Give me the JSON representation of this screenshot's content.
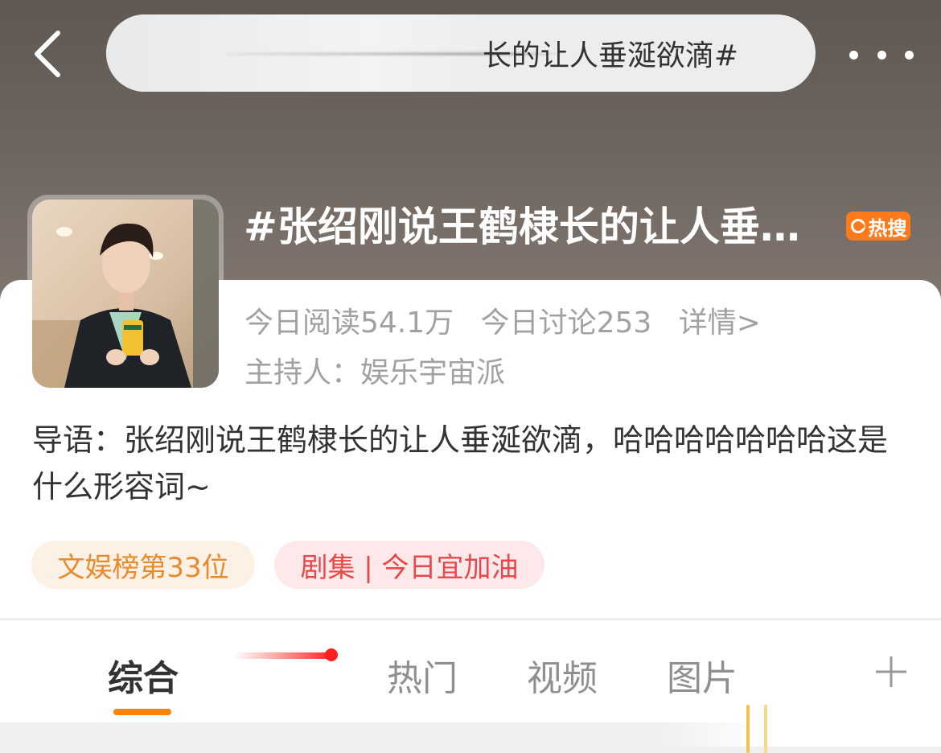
{
  "nav": {
    "search_text": "长的让人垂涎欲滴#"
  },
  "topic": {
    "title": "#张绍刚说王鹤棣长的让人垂…",
    "badge_label": "热搜",
    "stats": {
      "reads": "今日阅读54.1万",
      "discussions": "今日讨论253",
      "details": "详情>"
    },
    "host": "主持人：娱乐宇宙派",
    "intro": "导语：张绍刚说王鹤棣长的让人垂涎欲滴，哈哈哈哈哈哈哈这是什么形容词~",
    "tags": [
      "文娱榜第33位",
      "剧集 | 今日宜加油"
    ]
  },
  "tabs": [
    {
      "label": "综合",
      "active": true
    },
    {
      "label": "热门",
      "active": false
    },
    {
      "label": "视频",
      "active": false
    },
    {
      "label": "图片",
      "active": false
    }
  ],
  "icons": {
    "back": "chevron-left-icon",
    "more": "more-dots-icon",
    "hot": "hot-search-icon",
    "plus": "plus-icon"
  },
  "colors": {
    "accent_orange": "#ff8200",
    "hot_badge": "#ff7a1a",
    "rank_tag_text": "#e98a2c",
    "show_tag_text": "#e8484c"
  }
}
